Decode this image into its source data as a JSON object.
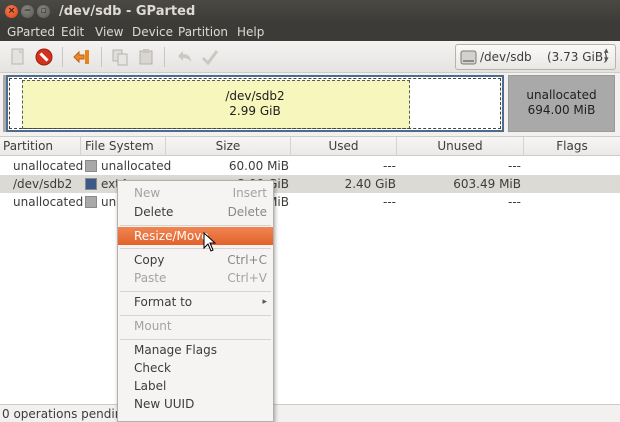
{
  "window": {
    "title": "/dev/sdb - GParted"
  },
  "menubar": [
    "GParted",
    "Edit",
    "View",
    "Device",
    "Partition",
    "Help"
  ],
  "device_selector": {
    "name": "/dev/sdb",
    "size": "(3.73 GiB)"
  },
  "graph": {
    "partition": {
      "name": "/dev/sdb2",
      "size": "2.99 GiB"
    },
    "unallocated": {
      "name": "unallocated",
      "size": "694.00 MiB"
    }
  },
  "table": {
    "columns": [
      "Partition",
      "File System",
      "Size",
      "Used",
      "Unused",
      "Flags"
    ],
    "rows": [
      {
        "partition": "unallocated",
        "fs": "unallocated",
        "fs_color": "#a9a9a9",
        "size": "60.00 MiB",
        "used": "---",
        "unused": "---",
        "flags": ""
      },
      {
        "partition": "/dev/sdb2",
        "fs": "ext4",
        "fs_color": "#3c5a87",
        "size": "2.99 GiB",
        "used": "2.40 GiB",
        "unused": "603.49 MiB",
        "flags": ""
      },
      {
        "partition": "unallocated",
        "fs": "unallocated",
        "fs_color": "#a9a9a9",
        "size": "694.00 MiB",
        "used": "---",
        "unused": "---",
        "flags": ""
      }
    ]
  },
  "status": {
    "text": "0 operations pending"
  },
  "context_menu": {
    "items": [
      {
        "label": "New",
        "accel": "Insert",
        "disabled": true
      },
      {
        "label": "Delete",
        "accel": "Delete",
        "disabled": false
      },
      {
        "label": "Resize/Move",
        "accel": "",
        "disabled": false,
        "highlighted": true
      },
      {
        "label": "Copy",
        "accel": "Ctrl+C",
        "disabled": false
      },
      {
        "label": "Paste",
        "accel": "Ctrl+V",
        "disabled": true
      },
      {
        "label": "Format to",
        "accel": "▸",
        "disabled": false
      },
      {
        "label": "Mount",
        "accel": "",
        "disabled": true
      },
      {
        "label": "Manage Flags",
        "accel": "",
        "disabled": false
      },
      {
        "label": "Check",
        "accel": "",
        "disabled": false
      },
      {
        "label": "Label",
        "accel": "",
        "disabled": false
      },
      {
        "label": "New UUID",
        "accel": "",
        "disabled": false
      }
    ]
  },
  "colors": {
    "highlight": "#e2622a",
    "partition_fill": "#f6f6bd",
    "unallocated": "#a9a9a9",
    "ext4": "#3c5a87"
  }
}
